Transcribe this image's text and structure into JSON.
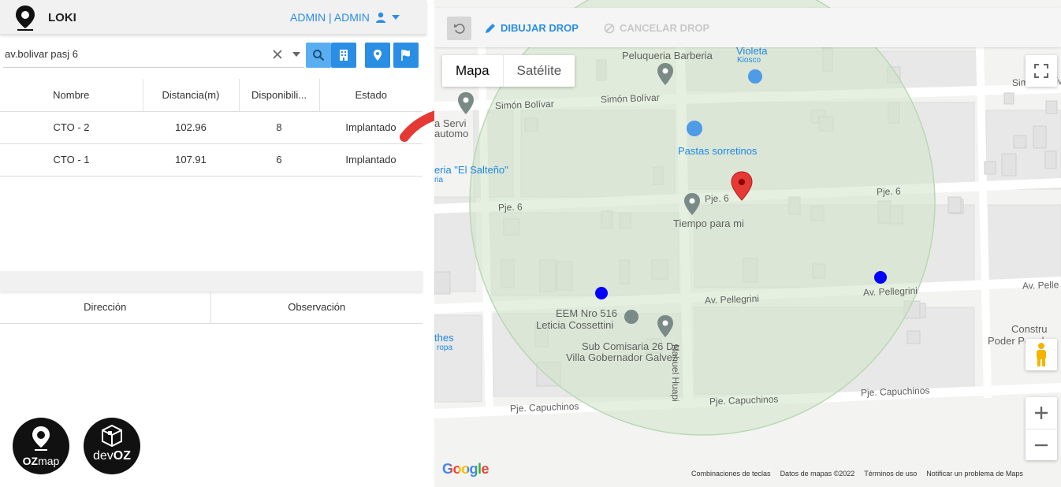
{
  "header": {
    "app_title": "LOKI",
    "user_label": "ADMIN | ADMIN"
  },
  "search": {
    "value": "av.bolivar pasj 6"
  },
  "results_table": {
    "columns": [
      "Nombre",
      "Distancia(m)",
      "Disponibili...",
      "Estado"
    ],
    "rows": [
      [
        "CTO - 2",
        "102.96",
        "8",
        "Implantado"
      ],
      [
        "CTO - 1",
        "107.91",
        "6",
        "Implantado"
      ]
    ]
  },
  "address_table": {
    "columns": [
      "Dirección",
      "Observación"
    ]
  },
  "logos": {
    "ozmap_oz": "OZ",
    "ozmap_map": "map",
    "devoz_dev": "dev",
    "devoz_oz": "OZ"
  },
  "map_toolbar": {
    "draw_label": "DIBUJAR DROP",
    "cancel_label": "CANCELAR DROP"
  },
  "map_type": {
    "map_label": "Mapa",
    "satellite_label": "Satélite"
  },
  "map_labels": {
    "roads": {
      "simon_bolivar_1": "Simón Bolívar",
      "simon_bolivar_2": "Simón Bolívar",
      "simon_bolivar_3": "Simón Bolív",
      "pje6_1": "Pje. 6",
      "pje6_2": "Pje. 6",
      "pje6_3": "Pje. 6",
      "pellegrini_1": "Av. Pellegrini",
      "pellegrini_2": "Av. Pellegrini",
      "pellegrini_3": "Av. Pelle",
      "nahuel_huapi": "Nahuel Huapi",
      "capuchinos_1": "Pje. Capuchinos",
      "capuchinos_2": "Pje. Capuchinos",
      "capuchinos_3": "Pje. Capuchinos"
    },
    "pois": {
      "violeta": "Violeta",
      "kiosco": "Kiosco",
      "peluqueria": "Peluqueria Barberia",
      "servicios_1": "a Servi",
      "servicios_2": "automo",
      "pastas": "Pastas sorretinos",
      "salteno": "eria \"El Salteño\"",
      "salteno_sub": "ria",
      "tiempo": "Tiempo para mi",
      "eem_1": "EEM Nro 516",
      "eem_2": "Leticia Cossettini",
      "comisaria_1": "Sub Comisaria 26 De",
      "comisaria_2": "Villa Gobernador Galvez",
      "thes": "thes",
      "thes_sub": "ropa",
      "construc_1": "Constru",
      "construc_2": "Poder Popular"
    }
  },
  "map_footer": {
    "google": "Google",
    "attribution": [
      "Combinaciones de teclas",
      "Datos de mapas ©2022",
      "Términos de uso",
      "Notificar un problema de Maps"
    ]
  },
  "colors": {
    "accent": "#2a8ee5",
    "marker_red": "#e53935",
    "cto_dot": "#0000ff",
    "coverage_fill": "#d8e8d4"
  }
}
